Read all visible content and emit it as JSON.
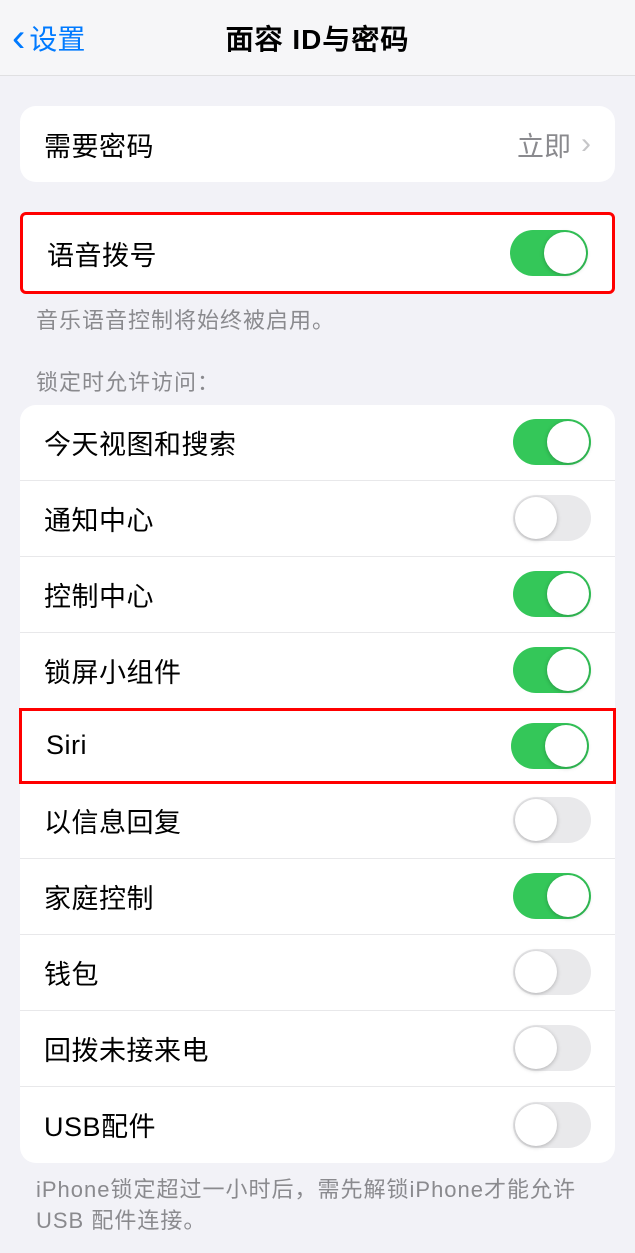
{
  "nav": {
    "back_label": "设置",
    "title": "面容 ID与密码"
  },
  "passcode": {
    "label": "需要密码",
    "value": "立即"
  },
  "voice_dial": {
    "label": "语音拨号",
    "on": true,
    "footer": "音乐语音控制将始终被启用。"
  },
  "access_header": "锁定时允许访问：",
  "access_items": [
    {
      "label": "今天视图和搜索",
      "on": true,
      "highlight": false
    },
    {
      "label": "通知中心",
      "on": false,
      "highlight": false
    },
    {
      "label": "控制中心",
      "on": true,
      "highlight": false
    },
    {
      "label": "锁屏小组件",
      "on": true,
      "highlight": false
    },
    {
      "label": "Siri",
      "on": true,
      "highlight": true
    },
    {
      "label": "以信息回复",
      "on": false,
      "highlight": false
    },
    {
      "label": "家庭控制",
      "on": true,
      "highlight": false
    },
    {
      "label": "钱包",
      "on": false,
      "highlight": false
    },
    {
      "label": "回拨未接来电",
      "on": false,
      "highlight": false
    },
    {
      "label": "USB配件",
      "on": false,
      "highlight": false
    }
  ],
  "usb_footer": "iPhone锁定超过一小时后，需先解锁iPhone才能允许USB 配件连接。"
}
